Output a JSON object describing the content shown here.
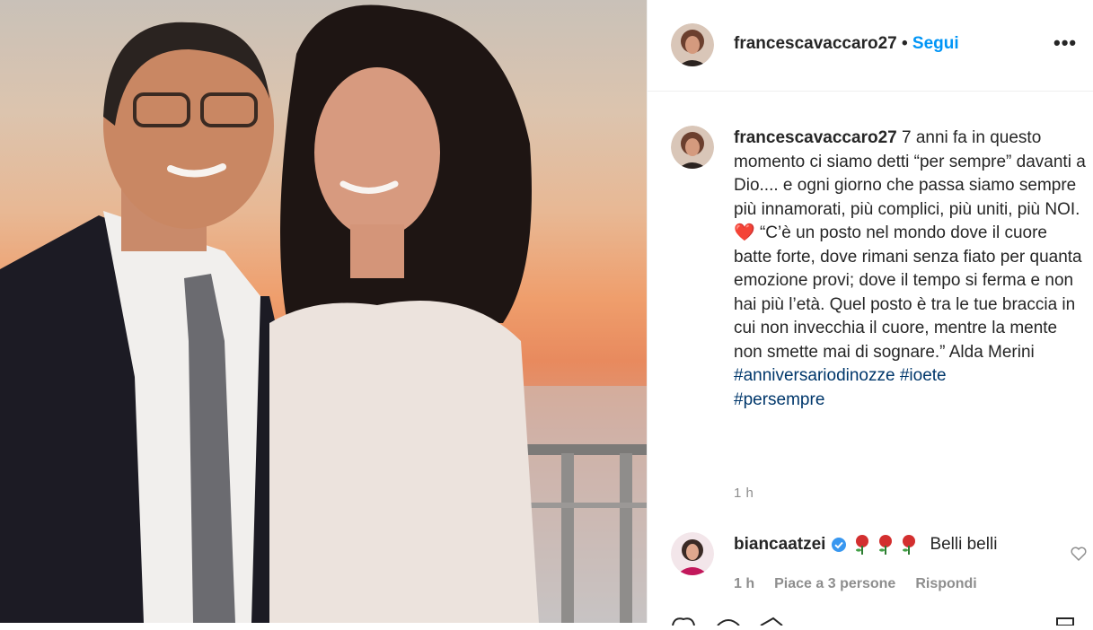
{
  "post": {
    "username": "francescavaccaro27",
    "follow_label": "Segui",
    "more_label": "•••",
    "separator": "•"
  },
  "caption": {
    "username": "francescavaccaro27",
    "text_1": "7 anni fa in questo momento ci siamo detti “per sempre” davanti a Dio.... e ogni giorno che passa siamo sempre più innamorati, più complici, più uniti, più NOI.",
    "heart": "❤️",
    "text_2": "“C’è un posto nel mondo dove il cuore batte forte, dove rimani senza fiato per quanta emozione provi; dove il tempo si ferma e non hai più l’età. Quel posto è tra le tue braccia in cui non invecchia il cuore, mentre la mente non smette mai di sognare.” Alda Merini",
    "hashtags": [
      "#anniversariodinozze",
      "#ioete",
      "#persempre"
    ],
    "time": "1 h"
  },
  "comment": {
    "username": "biancaatzei",
    "text": "Belli belli",
    "time": "1 h",
    "likes": "Piace a 3 persone",
    "reply": "Rispondi"
  },
  "colors": {
    "link": "#0095f6",
    "hashtag": "#00376b",
    "muted": "#8e8e8e",
    "verified": "#3897f0"
  }
}
